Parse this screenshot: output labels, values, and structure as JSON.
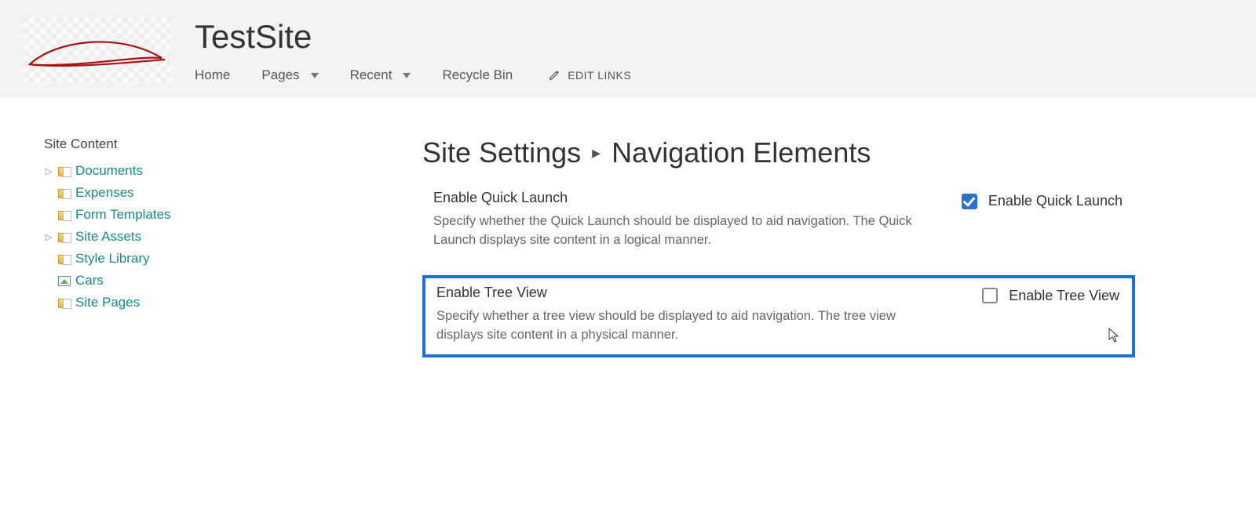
{
  "header": {
    "site_title": "TestSite",
    "nav": {
      "home": "Home",
      "pages": "Pages",
      "recent": "Recent",
      "recycle_bin": "Recycle Bin",
      "edit_links": "EDIT LINKS"
    }
  },
  "sidebar": {
    "heading": "Site Content",
    "items": [
      {
        "label": "Documents",
        "icon": "folder-doc",
        "expandable": true
      },
      {
        "label": "Expenses",
        "icon": "folder-doc",
        "expandable": false
      },
      {
        "label": "Form Templates",
        "icon": "folder-doc",
        "expandable": false
      },
      {
        "label": "Site Assets",
        "icon": "folder-doc",
        "expandable": true
      },
      {
        "label": "Style Library",
        "icon": "folder-doc",
        "expandable": false
      },
      {
        "label": "Cars",
        "icon": "image",
        "expandable": false
      },
      {
        "label": "Site Pages",
        "icon": "folder-doc",
        "expandable": false
      }
    ]
  },
  "breadcrumb": {
    "parent": "Site Settings",
    "current": "Navigation Elements"
  },
  "sections": {
    "quick_launch": {
      "title": "Enable Quick Launch",
      "desc": "Specify whether the Quick Launch should be displayed to aid navigation.  The Quick Launch displays site content in a logical manner.",
      "checkbox_label": "Enable Quick Launch",
      "checked": true
    },
    "tree_view": {
      "title": "Enable Tree View",
      "desc": "Specify whether a tree view should be displayed to aid navigation.  The tree view displays site content in a physical manner.",
      "checkbox_label": "Enable Tree View",
      "checked": false,
      "highlighted": true
    }
  }
}
